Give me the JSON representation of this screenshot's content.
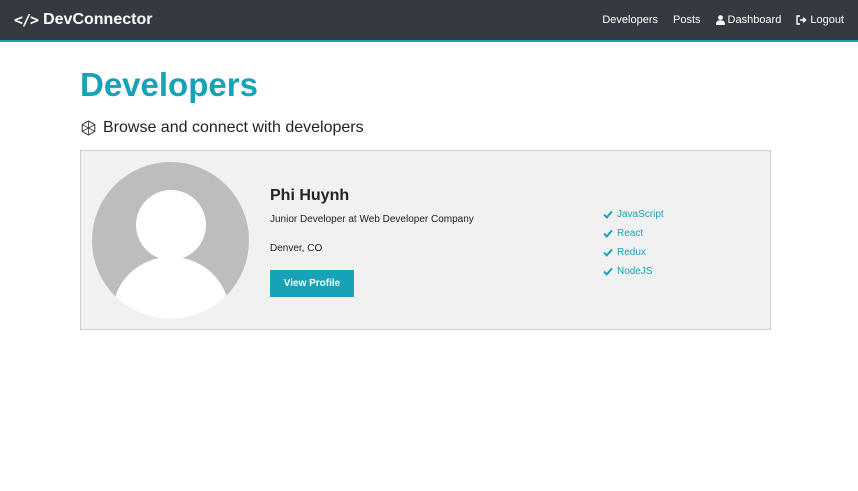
{
  "navbar": {
    "brand_icon": "</>",
    "brand": "DevConnector",
    "links": [
      {
        "label": "Developers",
        "icon": ""
      },
      {
        "label": "Posts",
        "icon": ""
      },
      {
        "label": "Dashboard",
        "icon": "user-icon"
      },
      {
        "label": "Logout",
        "icon": "sign-out-icon"
      }
    ]
  },
  "page": {
    "title": "Developers",
    "lead": "Browse and connect with developers",
    "lead_icon": "connect-develop-icon"
  },
  "profiles": [
    {
      "name": "Phi Huynh",
      "status": "Junior Developer at Web Developer Company",
      "location": "Denver, CO",
      "view_label": "View Profile",
      "skills": [
        "JavaScript",
        "React",
        "Redux",
        "NodeJS"
      ]
    }
  ],
  "colors": {
    "accent": "#17a2b8",
    "navbar": "#343a40",
    "card_bg": "#f1f1f1"
  }
}
